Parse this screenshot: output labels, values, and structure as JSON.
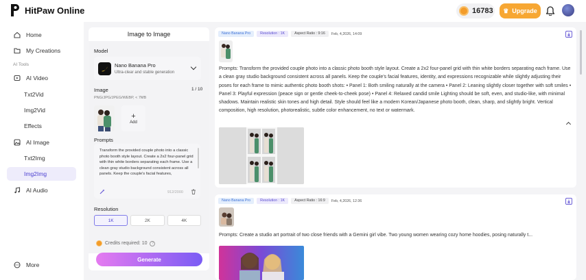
{
  "app": {
    "name": "HitPaw Online",
    "credits": "16783",
    "upgrade_label": "Upgrade"
  },
  "sidebar": {
    "items": [
      {
        "label": "Home",
        "icon": "home-icon"
      },
      {
        "label": "My Creations",
        "icon": "folder-icon"
      }
    ],
    "section_label": "AI Tools",
    "ai_video": {
      "label": "AI Video",
      "subs": [
        "Txt2Vid",
        "Img2Vid",
        "Effects"
      ]
    },
    "ai_image": {
      "label": "AI Image",
      "subs": [
        "Txt2Img",
        "Img2Img"
      ]
    },
    "ai_audio": {
      "label": "AI Audio"
    },
    "more": "More",
    "active_item": "Img2Img"
  },
  "panel": {
    "title": "Image to Image",
    "model_label": "Model",
    "model": {
      "name": "Nano Banana Pro",
      "desc": "Ultra-clear and stable generation"
    },
    "image_label": "Image",
    "image_count": "1 / 10",
    "image_formats": "PNG/JPG/JPEG/WEBP, < 7MB",
    "add_label": "Add",
    "prompts_label": "Prompts",
    "prompt_text": "Transform the provided couple photo into a classic photo booth style layout. Create a 2x2 four-panel grid with thin white borders separating each frame. Use a clean gray studio background consistent across all panels. Keep the couple's facial features,",
    "prompt_count": "912/2000",
    "resolution_label": "Resolution",
    "resolutions": [
      "1K",
      "2K",
      "4K"
    ],
    "selected_resolution": "1K",
    "credits_required": "Credits required: 10",
    "generate_label": "Generate"
  },
  "feed": [
    {
      "tags": [
        "Nano Banana Pro",
        "Resolution : 1K",
        "Aspect Ratio : 9:16"
      ],
      "date": "Feb, 4,2026, 14:09",
      "prompt": "Prompts: Transform the provided couple photo into a classic photo booth style layout. Create a 2x2 four-panel grid with thin white borders separating each frame. Use a clean gray studio background consistent across all panels. Keep the couple's facial features, identity, and expressions recognizable while slightly adjusting their poses for each frame to mimic authentic photo booth shots: • Panel 1: Both smiling naturally at the camera • Panel 2: Leaning slightly closer together with soft smiles • Panel 3: Playful expression (peace sign or gentle cheek-to-cheek pose) • Panel 4: Relaxed candid smile Lighting should be soft, even, and studio-like, with minimal shadows. Maintain realistic skin tones and high detail. Style should feel like a modern Korean/Japanese photo booth, clean, sharp, and slightly bright. Vertical composition, high resolution, photorealistic, subtle color enhancement, no text or watermark."
    },
    {
      "tags": [
        "Nano Banana Pro",
        "Resolution : 1K",
        "Aspect Ratio : 16:9"
      ],
      "date": "Feb, 4,2026, 12:36",
      "prompt": "Prompts: Create a studio art portrait of two close friends with a Gemini girl vibe. Two young women wearing cozy home hoodies, posing naturally t..."
    }
  ],
  "colors": {
    "accent": "#4b3fd1",
    "upgrade": "#f7a733",
    "coin": "#f39c2a"
  }
}
